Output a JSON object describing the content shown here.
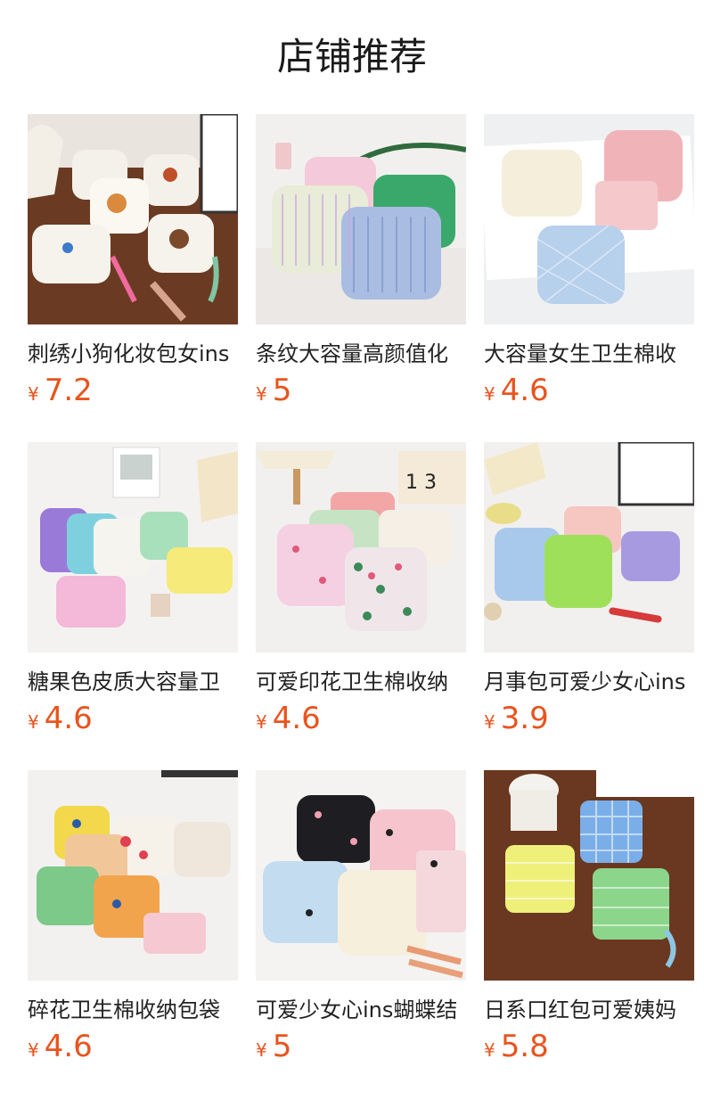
{
  "page": {
    "title": "店铺推荐"
  },
  "products": [
    {
      "title": "刺绣小狗化妆包女ins",
      "currency": "¥",
      "price": "7.2",
      "image": "embroidered-dog-pouches-photo"
    },
    {
      "title": "条纹大容量高颜值化",
      "currency": "¥",
      "price": "5",
      "image": "striped-knit-pouches-photo"
    },
    {
      "title": "大容量女生卫生棉收",
      "currency": "¥",
      "price": "4.6",
      "image": "quilted-pastel-pouches-photo"
    },
    {
      "title": "糖果色皮质大容量卫",
      "currency": "¥",
      "price": "4.6",
      "image": "candy-color-pouches-photo"
    },
    {
      "title": "可爱印花卫生棉收纳",
      "currency": "¥",
      "price": "4.6",
      "image": "floral-print-pouches-photo"
    },
    {
      "title": "月事包可爱少女心ins",
      "currency": "¥",
      "price": "3.9",
      "image": "period-pouches-photo"
    },
    {
      "title": "碎花卫生棉收纳包袋",
      "currency": "¥",
      "price": "4.6",
      "image": "patchwork-pouches-photo"
    },
    {
      "title": "可爱少女心ins蝴蝶结",
      "currency": "¥",
      "price": "5",
      "image": "bow-quilted-pouches-photo"
    },
    {
      "title": "日系口红包可爱姨妈",
      "currency": "¥",
      "price": "5.8",
      "image": "gingham-lipstick-pouches-photo"
    }
  ],
  "colors": {
    "price": "#e8541e",
    "title": "#222222"
  }
}
